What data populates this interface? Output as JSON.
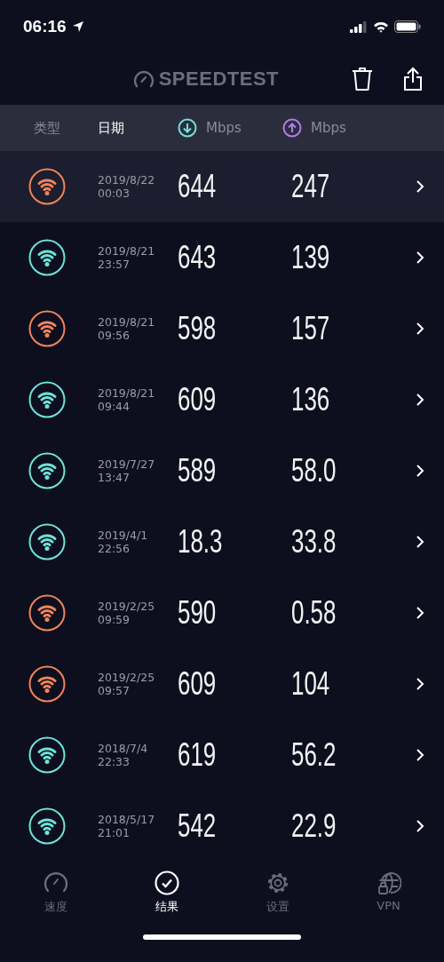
{
  "status_bar": {
    "time": "06:16"
  },
  "header": {
    "logo": "SPEEDTEST"
  },
  "columns": [
    {
      "label": "类型",
      "selected": false,
      "kind": "text"
    },
    {
      "label": "日期",
      "selected": true,
      "kind": "text"
    },
    {
      "label": "Mbps",
      "selected": false,
      "kind": "download"
    },
    {
      "label": "Mbps",
      "selected": false,
      "kind": "upload"
    }
  ],
  "results": [
    {
      "date": "2019/8/22",
      "time": "00:03",
      "download": "644",
      "upload": "247",
      "color": "#f0845c",
      "selected": true
    },
    {
      "date": "2019/8/21",
      "time": "23:57",
      "download": "643",
      "upload": "139",
      "color": "#6fe3d8",
      "selected": false
    },
    {
      "date": "2019/8/21",
      "time": "09:56",
      "download": "598",
      "upload": "157",
      "color": "#f0845c",
      "selected": false
    },
    {
      "date": "2019/8/21",
      "time": "09:44",
      "download": "609",
      "upload": "136",
      "color": "#6fe3d8",
      "selected": false
    },
    {
      "date": "2019/7/27",
      "time": "13:47",
      "download": "589",
      "upload": "58.0",
      "color": "#6fe3d8",
      "selected": false
    },
    {
      "date": "2019/4/1",
      "time": "22:56",
      "download": "18.3",
      "upload": "33.8",
      "color": "#6fe3d8",
      "selected": false
    },
    {
      "date": "2019/2/25",
      "time": "09:59",
      "download": "590",
      "upload": "0.58",
      "color": "#f0845c",
      "selected": false
    },
    {
      "date": "2019/2/25",
      "time": "09:57",
      "download": "609",
      "upload": "104",
      "color": "#f0845c",
      "selected": false
    },
    {
      "date": "2018/7/4",
      "time": "22:33",
      "download": "619",
      "upload": "56.2",
      "color": "#6fe3d8",
      "selected": false
    },
    {
      "date": "2018/5/17",
      "time": "21:01",
      "download": "542",
      "upload": "22.9",
      "color": "#6fe3d8",
      "selected": false
    }
  ],
  "tab_bar": [
    {
      "label": "速度",
      "kind": "speed",
      "selected": false
    },
    {
      "label": "结果",
      "kind": "results",
      "selected": true
    },
    {
      "label": "设置",
      "kind": "settings",
      "selected": false
    },
    {
      "label": "VPN",
      "kind": "vpn",
      "selected": false
    }
  ]
}
